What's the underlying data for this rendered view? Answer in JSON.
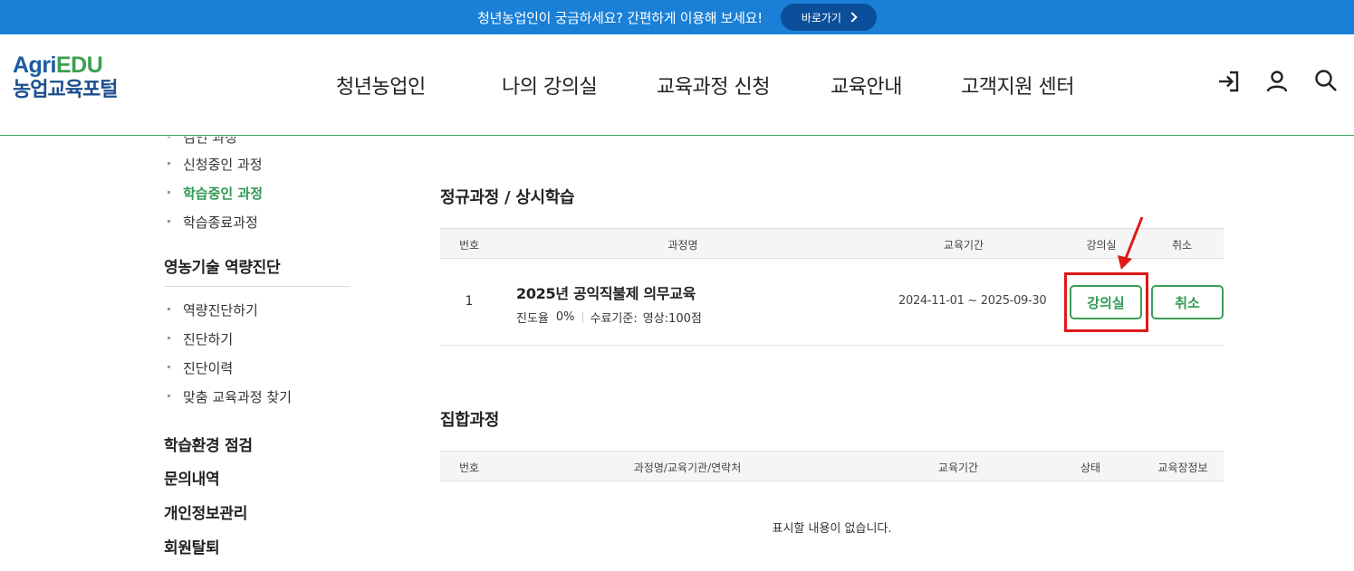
{
  "banner": {
    "text": "청년농업인이 궁금하세요? 간편하게 이용해 보세요!",
    "button_label": "바로가기"
  },
  "logo": {
    "agri": "Agri",
    "edu": "EDU",
    "subtitle": "농업교육포털"
  },
  "nav": {
    "items": [
      "청년농업인",
      "나의 강의실",
      "교육과정 신청",
      "교육안내",
      "고객지원 센터"
    ]
  },
  "header_icons": [
    "login-icon",
    "user-icon",
    "search-icon"
  ],
  "sidebar": {
    "cut_item": "검인 과정",
    "group1": [
      "신청중인 과정",
      "학습중인 과정",
      "학습종료과정"
    ],
    "active_item": "학습중인 과정",
    "diag_title": "영농기술 역량진단",
    "group2": [
      "역량진단하기",
      "진단하기",
      "진단이력",
      "맞춤 교육과정 찾기"
    ],
    "menus": [
      "학습환경 점검",
      "문의내역",
      "개인정보관리",
      "회원탈퇴"
    ]
  },
  "regular": {
    "title": "정규과정 / 상시학습",
    "headers": [
      "번호",
      "과정명",
      "교육기간",
      "강의실",
      "취소"
    ],
    "rows": [
      {
        "num": "1",
        "course": "2025년 공익직불제 의무교육",
        "progress_label": "진도율",
        "progress": "0%",
        "criteria_label": "수료기준:",
        "criteria": "영상:100점",
        "period": "2024-11-01 ~ 2025-09-30",
        "room_button": "강의실",
        "cancel_button": "취소"
      }
    ]
  },
  "group": {
    "title": "집합과정",
    "headers": [
      "번호",
      "과정명/교육기관/연락처",
      "교육기간",
      "상태",
      "교육장정보"
    ],
    "empty_text": "표시할 내용이 없습니다."
  },
  "colors": {
    "banner": "#1a7fd6",
    "accent_green": "#3b9d5a",
    "highlight_red": "#e01818"
  }
}
